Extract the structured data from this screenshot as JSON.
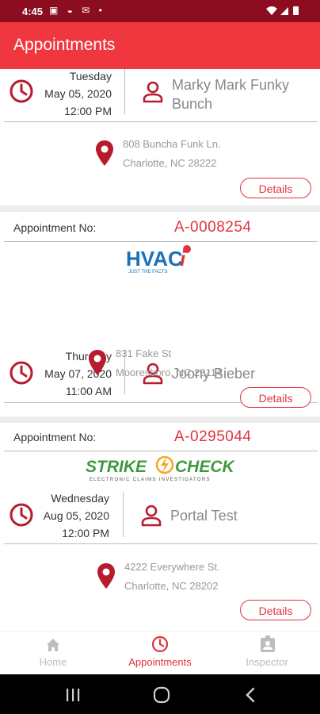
{
  "status": {
    "time": "4:45"
  },
  "header": {
    "title": "Appointments"
  },
  "appointments": [
    {
      "appointment_no_label": "",
      "appointment_no": "",
      "logo": "",
      "day": "Tuesday",
      "date": "May 05, 2020",
      "time": "12:00 PM",
      "customer": "Marky Mark Funky Bunch",
      "address_line1": "808 Buncha Funk Ln.",
      "address_line2": "Charlotte, NC 28222",
      "details_label": "Details"
    },
    {
      "appointment_no_label": "Appointment No:",
      "appointment_no": "A-0008254",
      "logo": "HVAC",
      "logo_tagline": "JUST THE FACTS",
      "day": "Thursday",
      "date": "May 07, 2020",
      "time": "11:00 AM",
      "customer": "Joony Bieber",
      "address_line1": "831 Fake St",
      "address_line2": "Mooresboro, NC 28114",
      "details_label": "Details"
    },
    {
      "appointment_no_label": "Appointment No:",
      "appointment_no": "A-0295044",
      "logo": "STRIKECHECK",
      "logo_left": "STRIKE",
      "logo_right": "CHECK",
      "logo_tagline": "ELECTRONIC CLAIMS INVESTIGATORS",
      "day": "Wednesday",
      "date": "Aug 05, 2020",
      "time": "12:00 PM",
      "customer": "Portal Test",
      "address_line1": "4222 Everywhere St.",
      "address_line2": "Charlotte, NC 28202",
      "details_label": "Details"
    }
  ],
  "nav": {
    "items": [
      {
        "label": "Home",
        "icon": "home-icon",
        "active": false
      },
      {
        "label": "Appointments",
        "icon": "clock-icon",
        "active": true
      },
      {
        "label": "Inspector",
        "icon": "badge-icon",
        "active": false
      }
    ]
  },
  "colors": {
    "accent": "#e0343e",
    "appbar": "#f0373f",
    "statusbar": "#8c0d20",
    "icon": "#b71c2d",
    "inactive": "#bdbdbd"
  }
}
